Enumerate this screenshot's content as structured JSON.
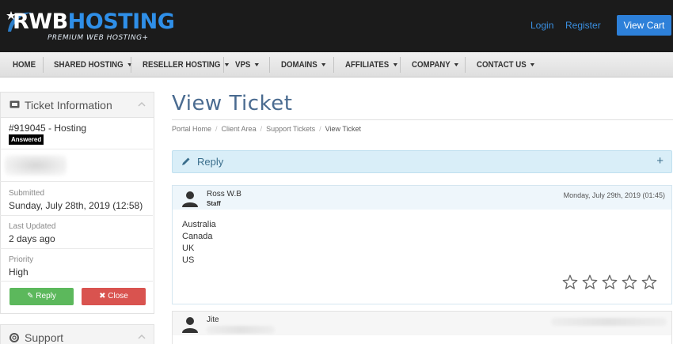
{
  "header": {
    "logo_rwb": "RWB",
    "logo_hosting": "HOSTING",
    "logo_tagline": "PREMIUM WEB HOSTING+",
    "login": "Login",
    "register": "Register",
    "view_cart": "View Cart"
  },
  "nav": {
    "items": [
      {
        "label": "HOME",
        "dropdown": false
      },
      {
        "label": "SHARED HOSTING",
        "dropdown": true
      },
      {
        "label": "RESELLER HOSTING",
        "dropdown": true
      },
      {
        "label": "VPS",
        "dropdown": true
      },
      {
        "label": "DOMAINS",
        "dropdown": true
      },
      {
        "label": "AFFILIATES",
        "dropdown": true
      },
      {
        "label": "COMPANY",
        "dropdown": true
      },
      {
        "label": "CONTACT US",
        "dropdown": true
      }
    ]
  },
  "sidebar": {
    "ticket_panel": {
      "title": "Ticket Information",
      "ticket_id": "#919045 - Hosting",
      "status": "Answered",
      "submitted_label": "Submitted",
      "submitted_value": "Sunday, July 28th, 2019 (12:58)",
      "updated_label": "Last Updated",
      "updated_value": "2 days ago",
      "priority_label": "Priority",
      "priority_value": "High",
      "reply_button": "Reply",
      "close_button": "Close"
    },
    "support_panel": {
      "title": "Support"
    }
  },
  "main": {
    "title": "View Ticket",
    "breadcrumb": [
      "Portal Home",
      "Client Area",
      "Support Tickets",
      "View Ticket"
    ],
    "reply_bar_label": "Reply",
    "reply_bar_toggle": "+",
    "messages": [
      {
        "name": "Ross W.B",
        "role": "Staff",
        "date": "Monday, July 29th, 2019 (01:45)",
        "lines": [
          "Australia",
          "Canada",
          "UK",
          "US"
        ],
        "rating_stars": 5
      },
      {
        "name": "Jite"
      }
    ]
  },
  "colors": {
    "header_bg": "#1b1b1b",
    "brand_blue": "#2d80d9",
    "title_blue": "#4a6b90",
    "reply_bar_bg": "#d9eef8",
    "success": "#5cb85c",
    "danger": "#d9534f"
  }
}
